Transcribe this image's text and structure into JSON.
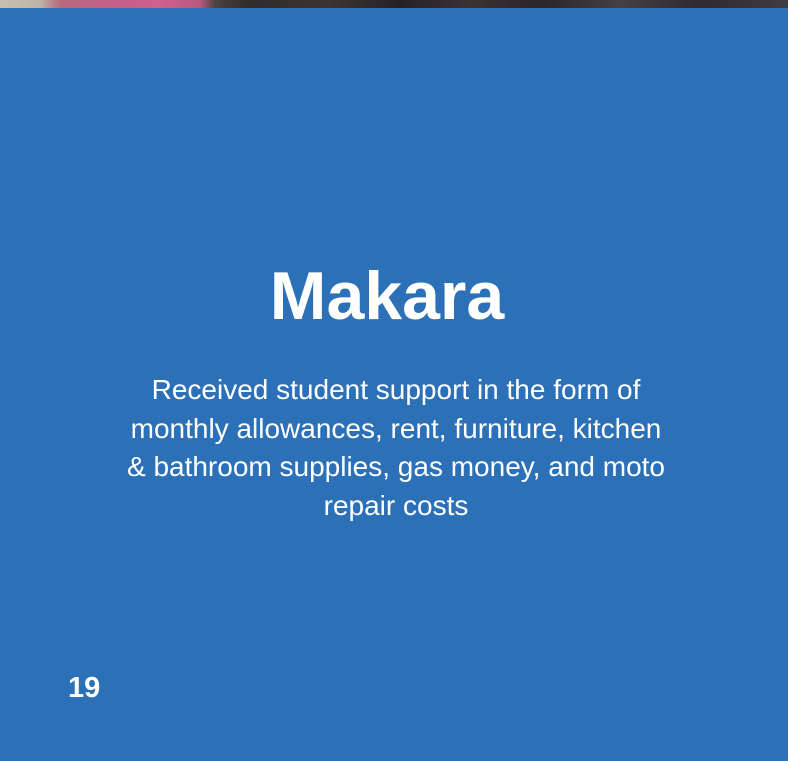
{
  "page": {
    "background_color": "#2c70b7",
    "text_color": "#ffffff"
  },
  "profile": {
    "name": "Makara",
    "description": "Received student support in the form of monthly allowances, rent, furniture, kitchen & bathroom supplies, gas money, and moto repair costs"
  },
  "footer": {
    "page_number": "19"
  }
}
